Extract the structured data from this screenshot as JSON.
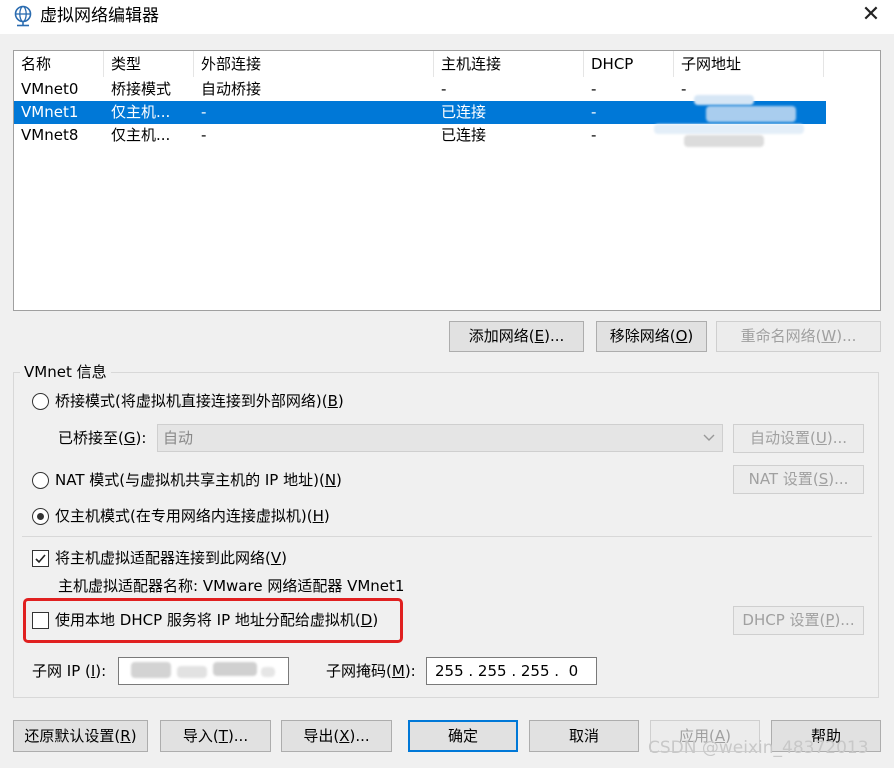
{
  "window": {
    "title": "虚拟网络编辑器",
    "close_glyph": "✕"
  },
  "list": {
    "columns": [
      "名称",
      "类型",
      "外部连接",
      "主机连接",
      "DHCP",
      "子网地址"
    ],
    "rows": [
      {
        "name": "VMnet0",
        "type": "桥接模式",
        "external": "自动桥接",
        "host": "-",
        "dhcp": "-",
        "subnet": "-"
      },
      {
        "name": "VMnet1",
        "type": "仅主机...",
        "external": "-",
        "host": "已连接",
        "dhcp": "-",
        "subnet": ""
      },
      {
        "name": "VMnet8",
        "type": "仅主机...",
        "external": "-",
        "host": "已连接",
        "dhcp": "-",
        "subnet": ""
      }
    ],
    "selected_index": 1
  },
  "list_buttons": {
    "add": {
      "text": "添加网络(",
      "key": "E",
      "suffix": ")..."
    },
    "remove": {
      "text": "移除网络(",
      "key": "O",
      "suffix": ")"
    },
    "rename": {
      "text": "重命名网络(",
      "key": "W",
      "suffix": ")..."
    }
  },
  "vmnet_info": {
    "group_title": "VMnet 信息",
    "bridged": {
      "text": "桥接模式(将虚拟机直接连接到外部网络)(",
      "key": "B",
      "suffix": ")"
    },
    "bridged_to": {
      "text": "已桥接至(",
      "key": "G",
      "suffix": "):",
      "value": "自动"
    },
    "auto_settings": {
      "text": "自动设置(",
      "key": "U",
      "suffix": ")..."
    },
    "nat": {
      "text": "NAT 模式(与虚拟机共享主机的 IP 地址)(",
      "key": "N",
      "suffix": ")"
    },
    "nat_settings": {
      "text": "NAT 设置(",
      "key": "S",
      "suffix": ")..."
    },
    "host_only": {
      "text": "仅主机模式(在专用网络内连接虚拟机)(",
      "key": "H",
      "suffix": ")"
    },
    "selected_mode": "host_only",
    "connect_adapter": {
      "text": "将主机虚拟适配器连接到此网络(",
      "key": "V",
      "suffix": ")",
      "checked": true
    },
    "adapter_name": "主机虚拟适配器名称: VMware 网络适配器 VMnet1",
    "use_dhcp": {
      "text": "使用本地 DHCP 服务将 IP 地址分配给虚拟机(",
      "key": "D",
      "suffix": ")",
      "checked": false
    },
    "dhcp_settings": {
      "text": "DHCP 设置(",
      "key": "P",
      "suffix": ")..."
    },
    "subnet_ip": {
      "text": "子网 IP (",
      "key": "I",
      "suffix": "):",
      "value": ""
    },
    "subnet_mask": {
      "text": "子网掩码(",
      "key": "M",
      "suffix": "):",
      "value": "255 . 255 . 255 .  0"
    }
  },
  "bottom_buttons": {
    "restore": {
      "text": "还原默认设置(",
      "key": "R",
      "suffix": ")"
    },
    "import": {
      "text": "导入(",
      "key": "T",
      "suffix": ")..."
    },
    "export": {
      "text": "导出(",
      "key": "X",
      "suffix": ")..."
    },
    "ok": "确定",
    "cancel": "取消",
    "apply": {
      "text": "应用(",
      "key": "A",
      "suffix": ")"
    },
    "help": "帮助"
  },
  "watermark": "CSDN @weixin_48372013",
  "colors": {
    "selection": "#0078d7",
    "highlight_box": "#e02020",
    "window_bg": "#f0f0f0"
  }
}
